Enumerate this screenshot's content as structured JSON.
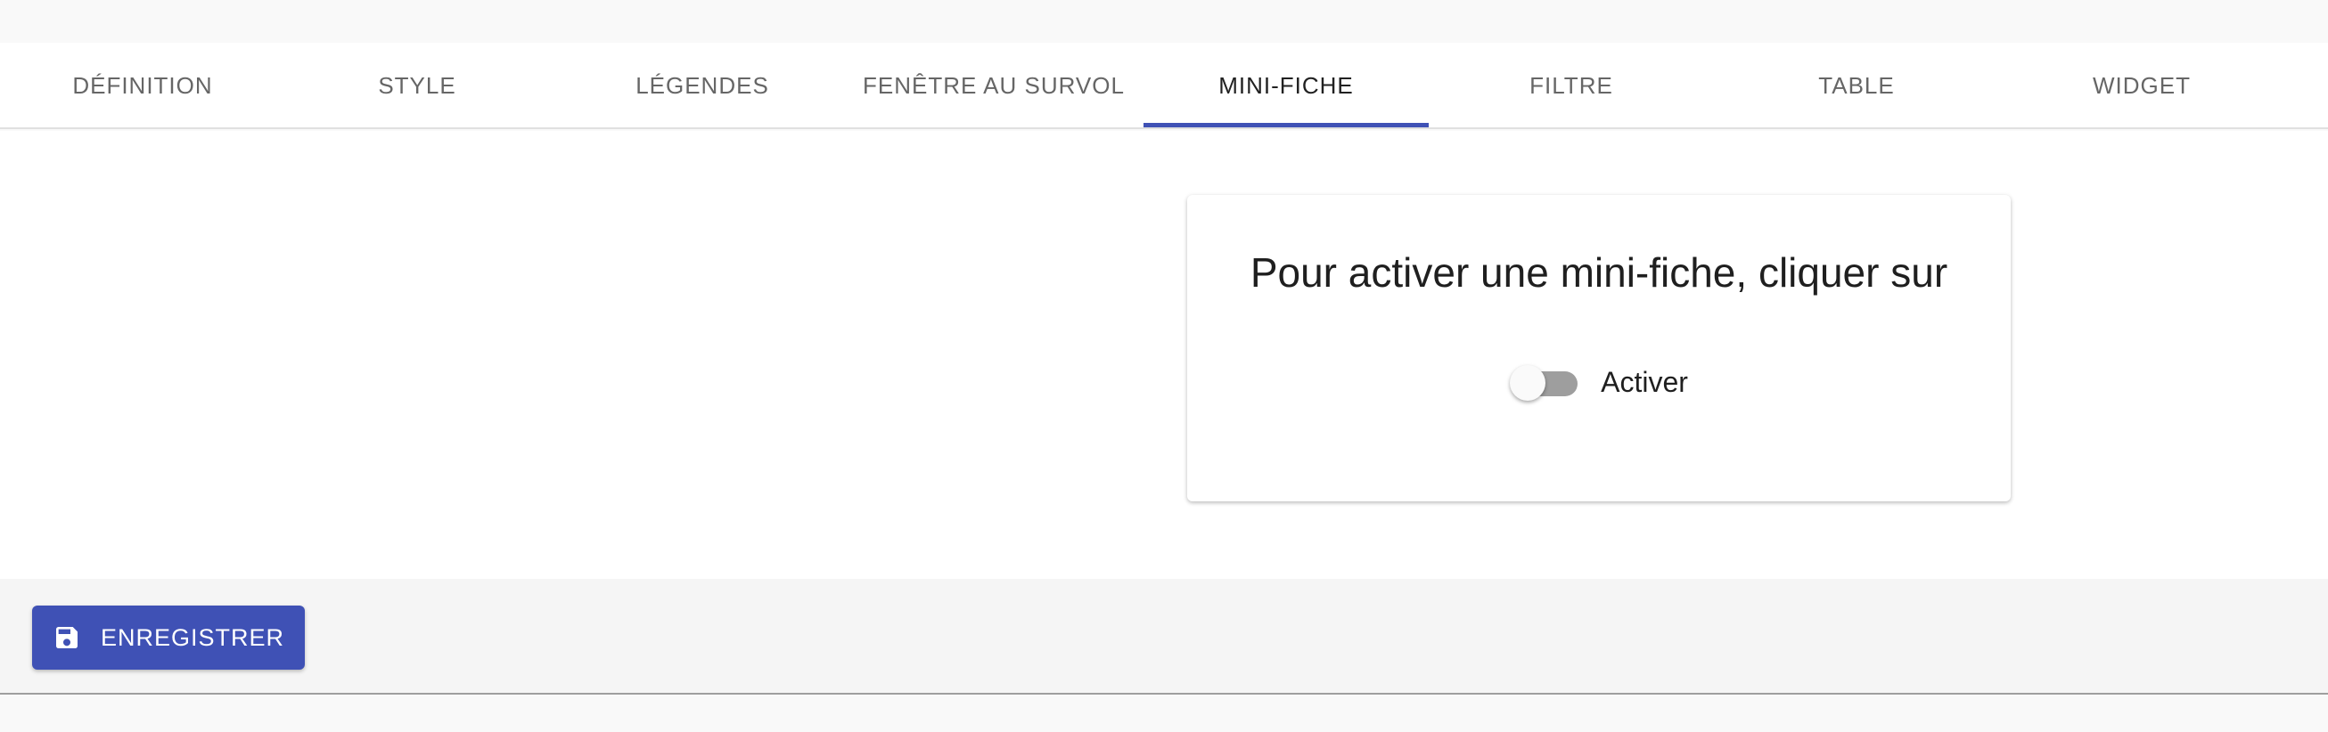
{
  "tabs": [
    {
      "label": "DÉFINITION"
    },
    {
      "label": "STYLE"
    },
    {
      "label": "LÉGENDES"
    },
    {
      "label": "FENÊTRE AU SURVOL"
    },
    {
      "label": "MINI-FICHE"
    },
    {
      "label": "FILTRE"
    },
    {
      "label": "TABLE"
    },
    {
      "label": "WIDGET"
    }
  ],
  "active_tab": "MINI-FICHE",
  "card": {
    "title": "Pour activer une mini-fiche, cliquer sur",
    "toggle_label": "Activer",
    "toggle_on": false
  },
  "footer": {
    "save_label": "ENREGISTRER",
    "save_icon": "floppy-disk-icon"
  },
  "colors": {
    "accent": "#3f51b5",
    "tab_text": "#666666",
    "active_tab_text": "#212121"
  }
}
